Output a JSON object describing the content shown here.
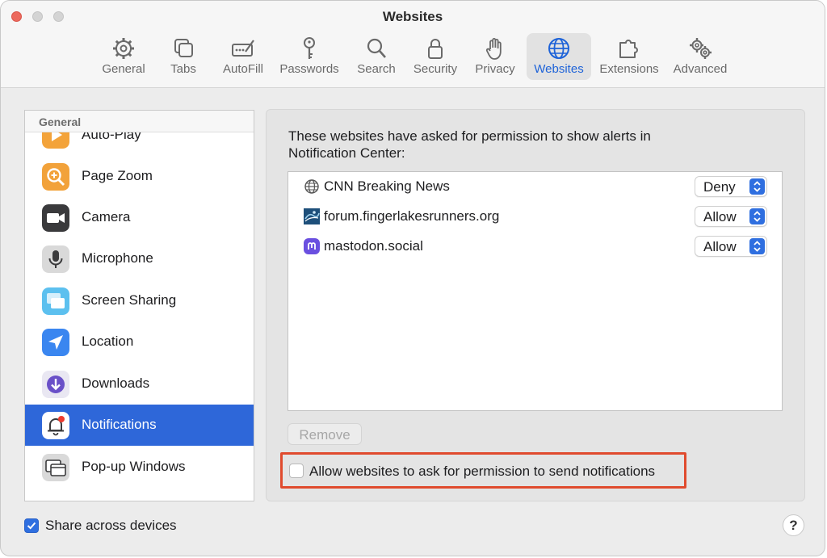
{
  "window": {
    "title": "Websites"
  },
  "toolbar": {
    "tabs": [
      {
        "label": "General",
        "icon": "gear-icon"
      },
      {
        "label": "Tabs",
        "icon": "tabs-icon"
      },
      {
        "label": "AutoFill",
        "icon": "autofill-icon"
      },
      {
        "label": "Passwords",
        "icon": "key-icon"
      },
      {
        "label": "Search",
        "icon": "magnifier-icon"
      },
      {
        "label": "Security",
        "icon": "lock-icon"
      },
      {
        "label": "Privacy",
        "icon": "hand-icon"
      },
      {
        "label": "Websites",
        "icon": "globe-icon",
        "active": true
      },
      {
        "label": "Extensions",
        "icon": "puzzle-icon"
      },
      {
        "label": "Advanced",
        "icon": "gears-icon"
      }
    ]
  },
  "sidebar": {
    "section": "General",
    "items": [
      {
        "label": "Auto-Play",
        "icon": "autoplay-icon"
      },
      {
        "label": "Page Zoom",
        "icon": "zoom-icon"
      },
      {
        "label": "Camera",
        "icon": "camera-icon"
      },
      {
        "label": "Microphone",
        "icon": "microphone-icon"
      },
      {
        "label": "Screen Sharing",
        "icon": "screen-sharing-icon"
      },
      {
        "label": "Location",
        "icon": "location-icon"
      },
      {
        "label": "Downloads",
        "icon": "downloads-icon"
      },
      {
        "label": "Notifications",
        "icon": "bell-icon",
        "selected": true
      },
      {
        "label": "Pop-up Windows",
        "icon": "popup-windows-icon"
      }
    ]
  },
  "main": {
    "description": "These websites have asked for permission to show alerts in Notification Center:",
    "sites": [
      {
        "name": "CNN Breaking News",
        "setting": "Deny",
        "icon": "globe-icon"
      },
      {
        "name": "forum.fingerlakesrunners.org",
        "setting": "Allow",
        "icon": "site-favicon-icon"
      },
      {
        "name": "mastodon.social",
        "setting": "Allow",
        "icon": "mastodon-icon"
      }
    ],
    "remove_label": "Remove",
    "allow_checkbox": {
      "label": "Allow websites to ask for permission to send notifications",
      "checked": false
    }
  },
  "footer": {
    "share": {
      "label": "Share across devices",
      "checked": true
    },
    "help_label": "?"
  },
  "colors": {
    "accent": "#2e67d9",
    "highlight": "#e04b2e"
  }
}
